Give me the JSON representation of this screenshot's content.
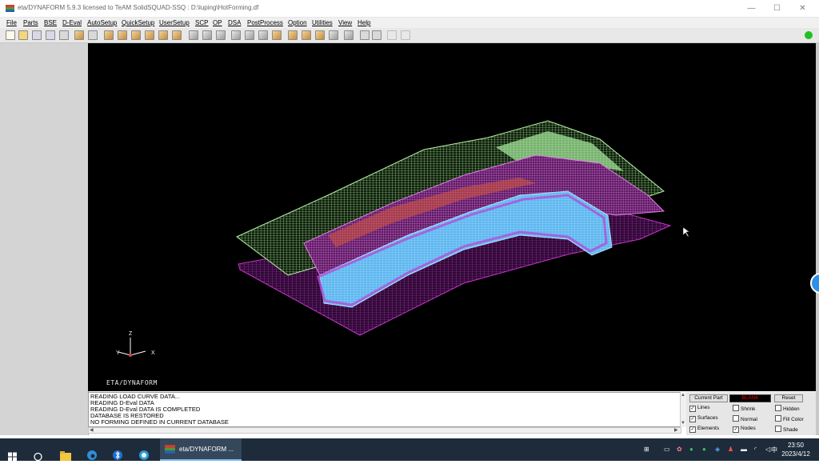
{
  "window": {
    "title": "eta/DYNAFORM 5.9.3 licensed to TeAM SolidSQUAD-SSQ : D:\\luping\\HotForming.df",
    "minimize": "—",
    "maximize": "☐",
    "close": "✕"
  },
  "menu": [
    "File",
    "Parts",
    "BSE",
    "D-Eval",
    "AutoSetup",
    "QuickSetup",
    "UserSetup",
    "SCP",
    "OP",
    "DSA",
    "PostProcess",
    "Option",
    "Utilities",
    "View",
    "Help"
  ],
  "viewport": {
    "axis_z": "Z",
    "axis_x": "X",
    "axis_y": "Y",
    "brand": "ETA/DYNAFORM",
    "mesh_colors": {
      "binder_mesh": "#b9f5a8",
      "lower_mesh": "#c233c8",
      "blank_mesh": "#d56bdc",
      "punch_mesh": "#8ecff5"
    }
  },
  "messages": [
    "READING LOAD CURVE DATA...",
    "READING D-Eval DATA",
    "READING D-Eval DATA IS COMPLETED",
    "DATABASE IS RESTORED",
    "NO FORMING DEFINED IN CURRENT DATABASE"
  ],
  "display_control": {
    "current_part_label": "Current Part",
    "current_part_value": "BLANK",
    "reset_label": "Reset",
    "options": [
      {
        "label": "Lines",
        "checked": true
      },
      {
        "label": "Shrink",
        "checked": false
      },
      {
        "label": "Hidden",
        "checked": false
      },
      {
        "label": "Surfaces",
        "checked": true
      },
      {
        "label": "Normal",
        "checked": false
      },
      {
        "label": "Fill Color",
        "checked": false
      },
      {
        "label": "Elements",
        "checked": true
      },
      {
        "label": "Nodes",
        "checked": true
      },
      {
        "label": "Shade",
        "checked": false
      }
    ]
  },
  "taskbar": {
    "active_app": "eta/DYNAFORM ...",
    "time": "23:50",
    "date": "2023/4/12",
    "ime": "中"
  }
}
